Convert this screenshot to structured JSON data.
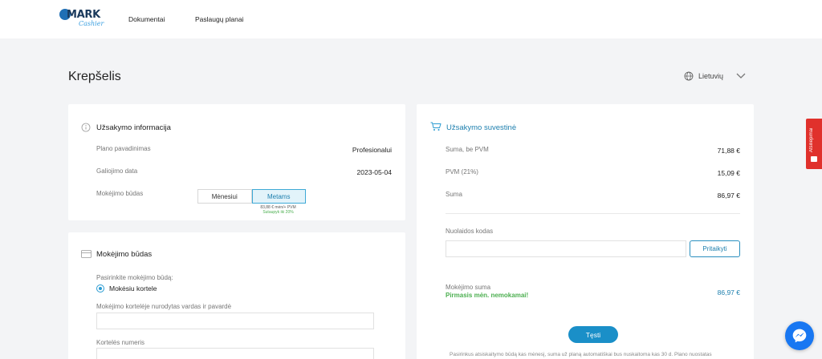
{
  "nav": {
    "logo_text": "MARK",
    "logo_sub": "Cashier",
    "links": [
      "Dokumentai",
      "Paslaugų planai"
    ]
  },
  "page": {
    "title": "Krepšelis",
    "language": "Lietuvių"
  },
  "order_info": {
    "title": "Užsakymo informacija",
    "plan_label": "Plano pavadinimas",
    "plan_value": "Profesionalui",
    "valid_label": "Galiojimo data",
    "valid_value": "2023-05-04",
    "payment_label": "Mokėjimo būdas",
    "options": [
      "Mėnesiui",
      "Metams"
    ],
    "selected_option": "Metams",
    "price_note": "83,88 € mėn/+ PVM",
    "savings_note": "Sutaupyk iki 20%"
  },
  "payment_method": {
    "title": "Mokėjimo būdas",
    "choose_label": "Pasirinkite mokėjimo būdą:",
    "option_card": "Mokėsiu kortele",
    "name_label": "Mokėjimo kortelėje nurodytas vardas ir pavardė",
    "name_value": "",
    "number_label": "Kortelės numeris",
    "number_value": ""
  },
  "summary": {
    "title": "Užsakymo suvestinė",
    "subtotal_label": "Suma, be PVM",
    "subtotal_value": "71,88 €",
    "vat_label": "PVM (21%)",
    "vat_value": "15,09 €",
    "total_label": "Suma",
    "total_value": "86,97 €",
    "discount_label": "Nuolaidos kodas",
    "discount_value": "",
    "apply_label": "Pritaikyti",
    "payment_sum_label": "Mokėjimo suma",
    "free_month": "Pirmasis mėn. nemokamai!",
    "payment_sum_value": "86,97 €",
    "continue_label": "Tęsti",
    "footnote": "Pasirinkus atsiskaitymo būdą kas mėnesį, suma už planą automatiškai bus nuskaitoma kas 30 d. Plano nuostatas"
  },
  "feedback": {
    "label": "Atsiliepimai"
  },
  "colors": {
    "accent": "#1a8fc8",
    "free_green": "#4caf50",
    "feedback_red": "#e0312c",
    "messenger_blue": "#1877f2"
  }
}
